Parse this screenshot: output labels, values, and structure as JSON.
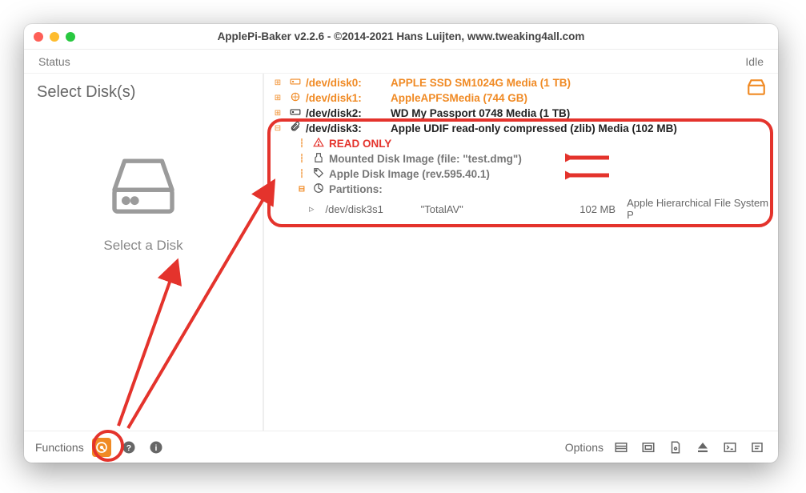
{
  "window": {
    "title": "ApplePi-Baker v2.2.6 - ©2014-2021 Hans Luijten, www.tweaking4all.com"
  },
  "status": {
    "label": "Status",
    "value": "Idle"
  },
  "left": {
    "heading": "Select Disk(s)",
    "placeholder": "Select a Disk"
  },
  "disks": [
    {
      "dev": "/dev/disk0:",
      "desc": "APPLE SSD SM1024G Media  (1 TB)",
      "style": "orange"
    },
    {
      "dev": "/dev/disk1:",
      "desc": "AppleAPFSMedia  (744 GB)",
      "style": "orange"
    },
    {
      "dev": "/dev/disk2:",
      "desc": "WD My Passport 0748 Media  (1 TB)",
      "style": "black"
    },
    {
      "dev": "/dev/disk3:",
      "desc": "Apple UDIF read-only compressed (zlib) Media  (102 MB)",
      "style": "black",
      "expanded": true
    }
  ],
  "disk3_details": {
    "read_only": "READ ONLY",
    "mounted": "Mounted Disk Image  (file: \"test.dmg\")",
    "image_rev": "Apple Disk Image (rev.595.40.1)",
    "partitions_label": "Partitions:",
    "partition": {
      "dev": "/dev/disk3s1",
      "name": "\"TotalAV\"",
      "size": "102 MB",
      "fs": "Apple Hierarchical File System P"
    }
  },
  "footer": {
    "functions_label": "Functions",
    "options_label": "Options"
  }
}
